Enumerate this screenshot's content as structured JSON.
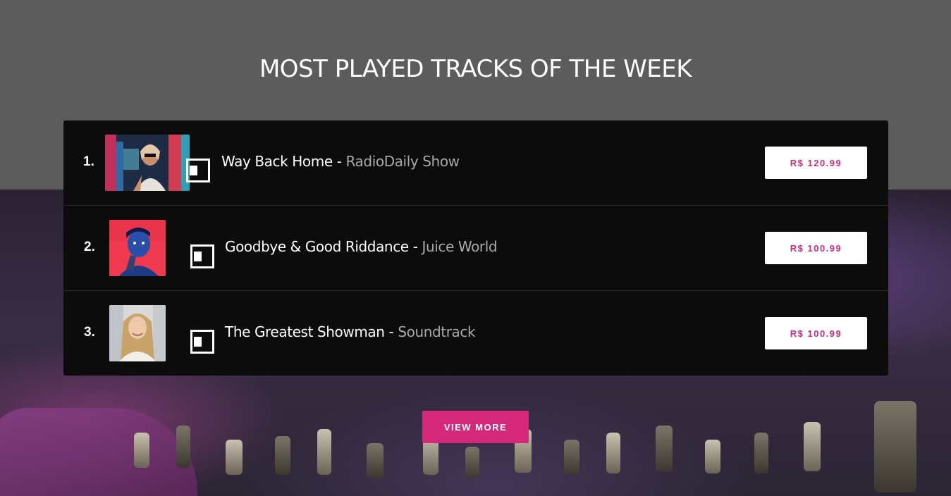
{
  "section": {
    "title": "MOST PLAYED TRACKS OF THE WEEK"
  },
  "tracks": [
    {
      "rank": "1.",
      "song": "Way Back Home",
      "separator": "-",
      "artist": "RadioDaily Show",
      "price": "R$ 120.99"
    },
    {
      "rank": "2.",
      "song": "Goodbye & Good Riddance",
      "separator": "-",
      "artist": "Juice World",
      "price": "R$ 100.99"
    },
    {
      "rank": "3.",
      "song": "The Greatest Showman",
      "separator": "-",
      "artist": "Soundtrack",
      "price": "R$ 100.99"
    }
  ],
  "actions": {
    "view_more": "VIEW MORE"
  },
  "colors": {
    "accent": "#d6287a",
    "panel": "#0c0c0c",
    "header_bg": "#5c5c5c",
    "artist_text": "#a9a9a9"
  },
  "icons": {
    "play": "play-icon"
  }
}
